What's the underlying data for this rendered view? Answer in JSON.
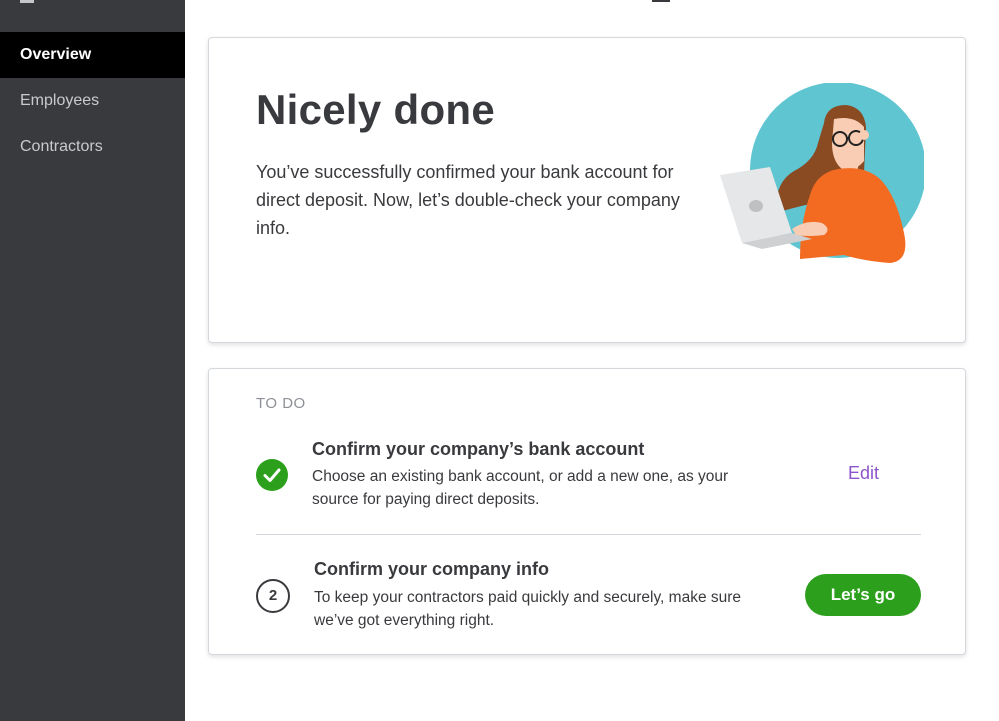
{
  "sidebar": {
    "items": [
      {
        "label": "Overview",
        "active": true
      },
      {
        "label": "Employees",
        "active": false
      },
      {
        "label": "Contractors",
        "active": false
      }
    ]
  },
  "hero": {
    "title": "Nicely done",
    "text": "You’ve successfully confirmed your bank account for direct deposit. Now, let’s double-check your company info.",
    "illustration": "woman-with-laptop-illustration"
  },
  "todo": {
    "heading": "TO DO",
    "tasks": [
      {
        "status": "complete",
        "status_icon": "checkmark-icon",
        "title": "Confirm your company’s bank account",
        "description": "Choose an existing bank account, or add a new one, as your source for paying direct deposits.",
        "action_label": "Edit"
      },
      {
        "status": "pending",
        "step_number": "2",
        "title": "Confirm your company info",
        "description": "To keep your contractors paid quickly and securely, make sure we’ve got everything right.",
        "action_label": "Let’s go"
      }
    ]
  },
  "colors": {
    "sidebar_bg": "#393a3d",
    "sidebar_active_bg": "#000000",
    "accent_green": "#2ca01c",
    "link_purple": "#8d54cc"
  }
}
